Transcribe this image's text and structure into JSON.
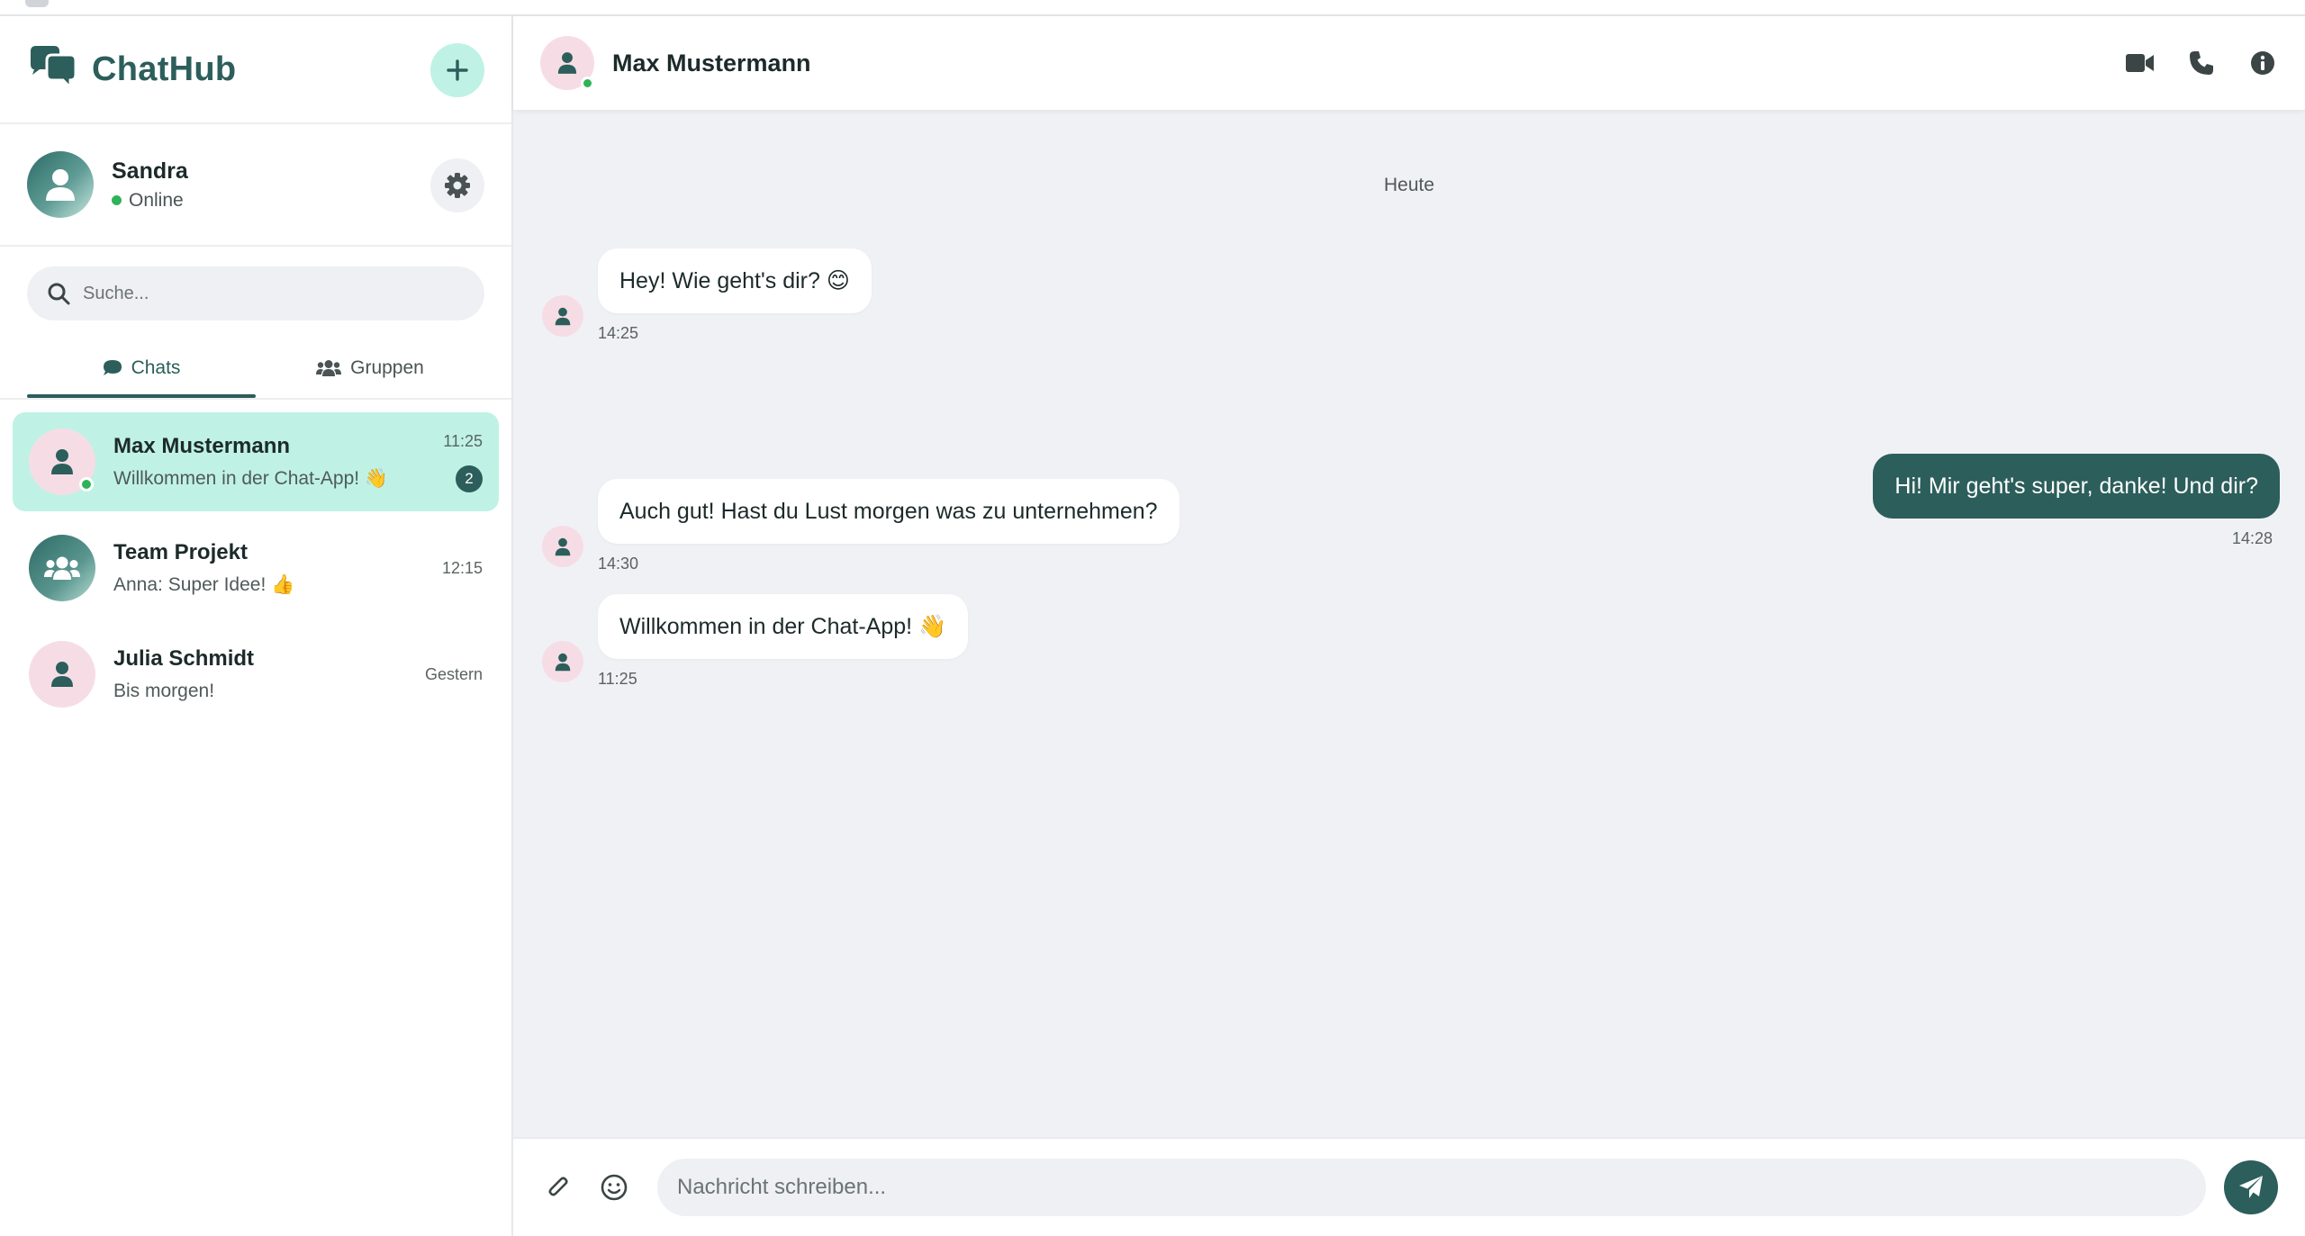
{
  "app": {
    "brand": "ChatHub",
    "accent_color": "#2c5e5b",
    "highlight_color": "#bff2e4"
  },
  "profile": {
    "name": "Sandra",
    "status": "Online"
  },
  "search": {
    "placeholder": "Suche..."
  },
  "tabs": [
    {
      "label": "Chats",
      "icon": "chat-bubble-icon",
      "active": true
    },
    {
      "label": "Gruppen",
      "icon": "users-icon",
      "active": false
    }
  ],
  "chats": [
    {
      "name": "Max Mustermann",
      "preview": "Willkommen in der Chat-App! 👋",
      "time": "11:25",
      "unread": "2",
      "online": true,
      "active": true
    },
    {
      "name": "Team Projekt",
      "preview": "Anna: Super Idee! 👍",
      "time": "12:15",
      "group": true
    },
    {
      "name": "Julia Schmidt",
      "preview": "Bis morgen!",
      "time": "Gestern"
    }
  ],
  "conversation": {
    "contact_name": "Max Mustermann",
    "date_separator": "Heute",
    "messages": [
      {
        "direction": "in",
        "text": "Hey! Wie geht's dir? 😊",
        "time": "14:25"
      },
      {
        "direction": "out",
        "text": "Hi! Mir geht's super, danke! Und dir?",
        "time": "14:28"
      },
      {
        "direction": "in",
        "text": "Auch gut! Hast du Lust morgen was zu unternehmen?",
        "time": "14:30"
      },
      {
        "direction": "in",
        "text": "Willkommen in der Chat-App! 👋",
        "time": "11:25"
      }
    ]
  },
  "composer": {
    "placeholder": "Nachricht schreiben..."
  }
}
